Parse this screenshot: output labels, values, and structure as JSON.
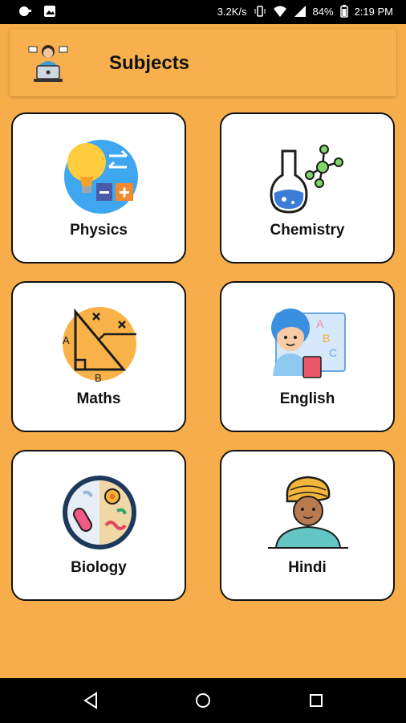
{
  "status_bar": {
    "speed": "3.2K/s",
    "battery": "84%",
    "time": "2:19 PM"
  },
  "header": {
    "title": "Subjects",
    "logo_icon": "teacher-laptop-icon"
  },
  "subjects": [
    {
      "label": "Physics",
      "icon": "physics-icon"
    },
    {
      "label": "Chemistry",
      "icon": "chemistry-icon"
    },
    {
      "label": "Maths",
      "icon": "maths-icon"
    },
    {
      "label": "English",
      "icon": "english-icon"
    },
    {
      "label": "Biology",
      "icon": "biology-icon"
    },
    {
      "label": "Hindi",
      "icon": "hindi-icon"
    }
  ],
  "colors": {
    "background": "#f6ad4a",
    "card": "#ffffff",
    "border": "#111111"
  }
}
